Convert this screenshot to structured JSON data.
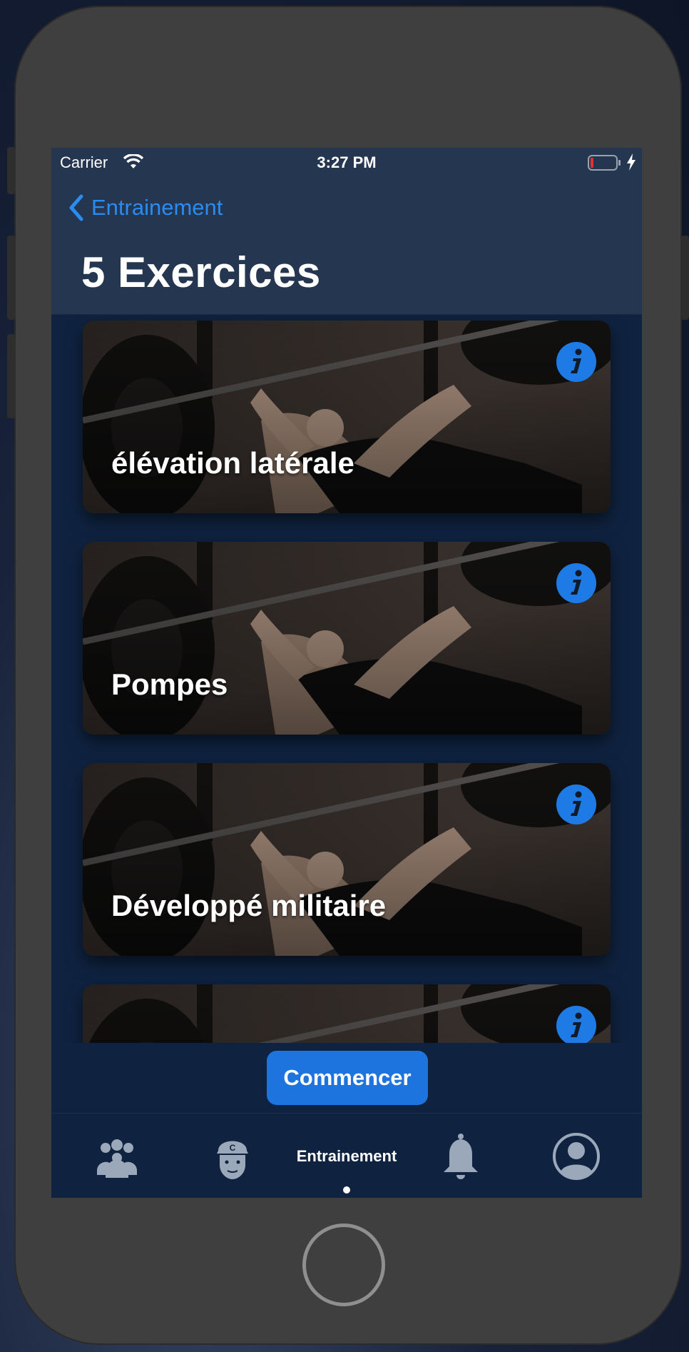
{
  "status_bar": {
    "carrier": "Carrier",
    "time": "3:27 PM"
  },
  "nav": {
    "back_label": "Entrainement",
    "title": "5 Exercices"
  },
  "exercises": [
    {
      "name": "élévation latérale"
    },
    {
      "name": "Pompes"
    },
    {
      "name": "Développé militaire"
    },
    {
      "name": ""
    }
  ],
  "start_button": {
    "label": "Commencer"
  },
  "tabbar": {
    "items": [
      {
        "icon": "group-icon"
      },
      {
        "icon": "coach-icon"
      },
      {
        "label": "Entrainement"
      },
      {
        "icon": "bell-icon"
      },
      {
        "icon": "profile-icon"
      }
    ]
  },
  "colors": {
    "accent": "#1e7be6",
    "nav_background": "#243650",
    "screen_background": "#0f2340",
    "battery_low": "#e53030"
  }
}
